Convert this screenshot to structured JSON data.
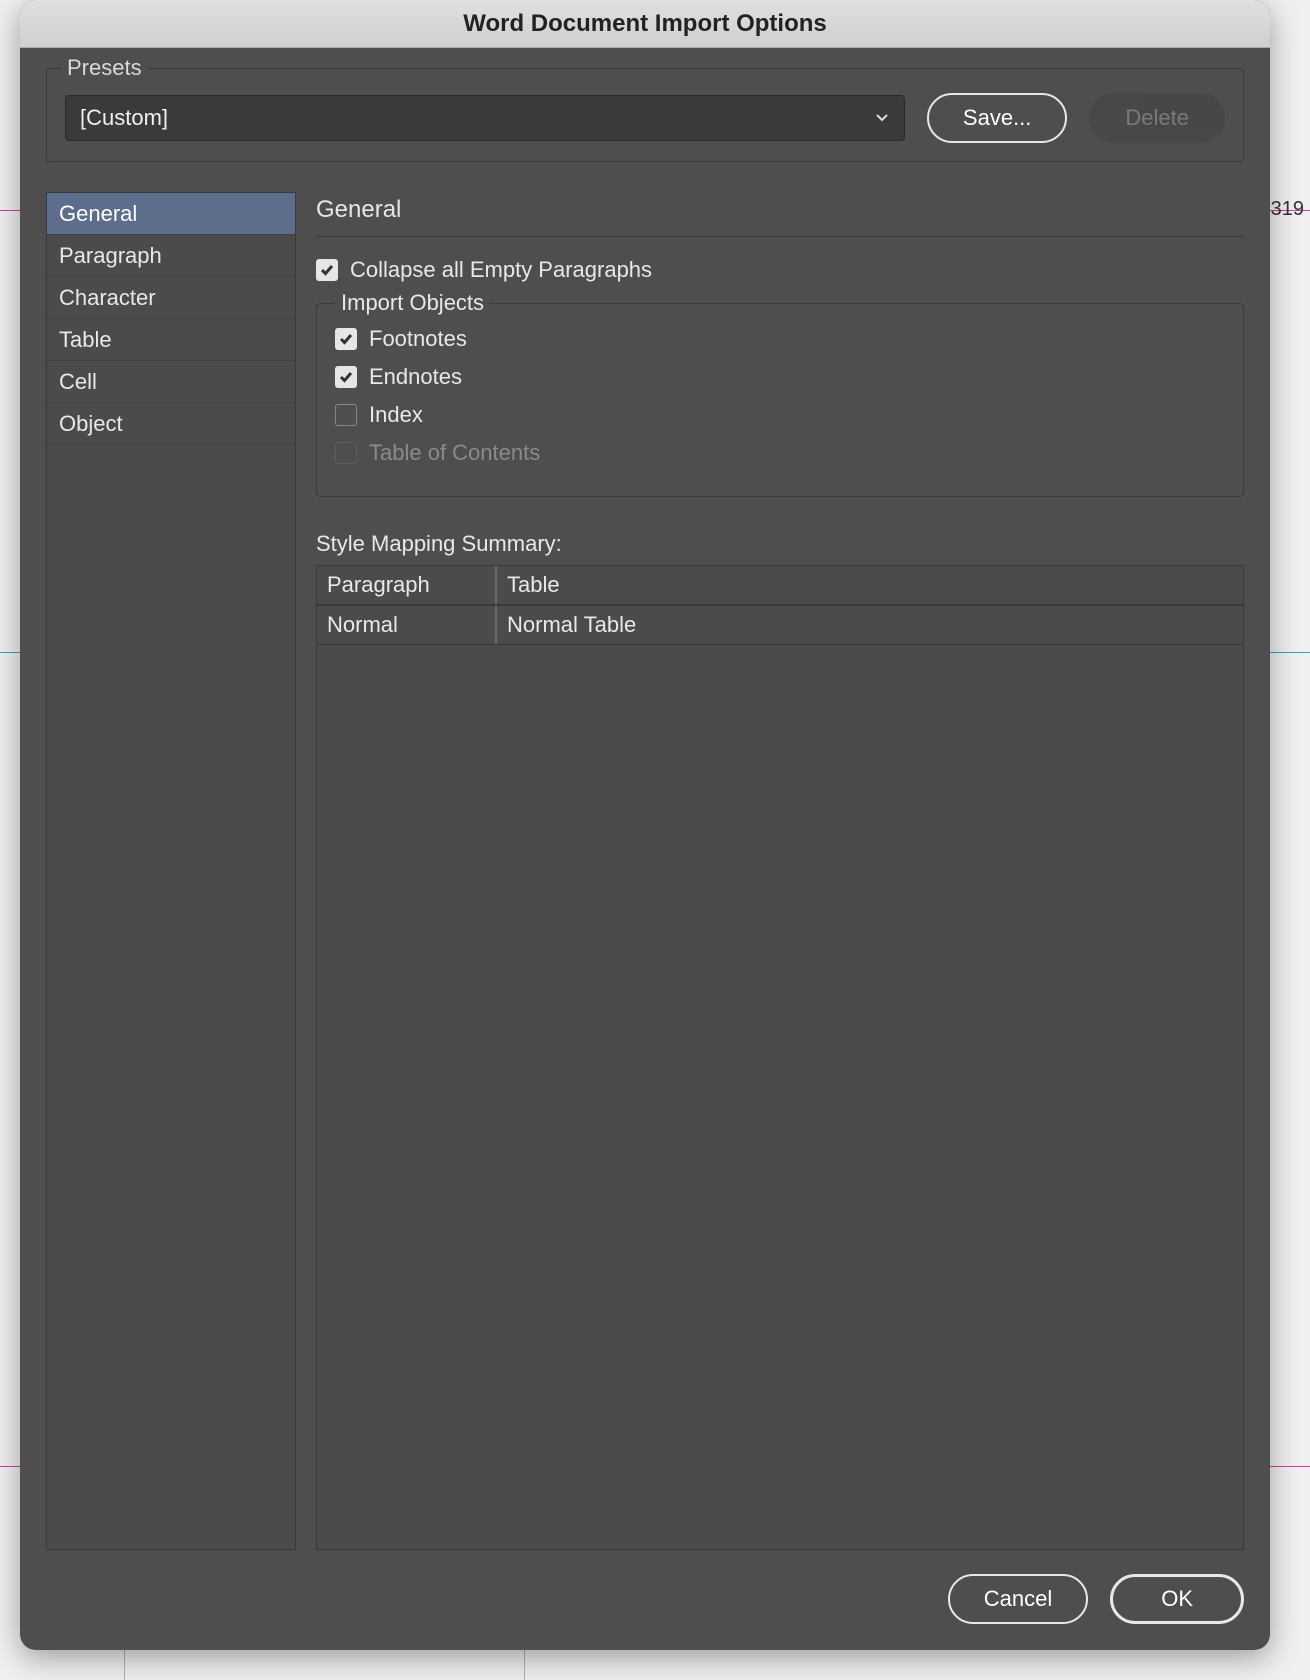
{
  "dialog": {
    "title": "Word Document Import Options",
    "presets": {
      "legend": "Presets",
      "selected": "[Custom]",
      "save_label": "Save...",
      "delete_label": "Delete"
    },
    "sidebar": {
      "items": [
        {
          "label": "General",
          "active": true
        },
        {
          "label": "Paragraph",
          "active": false
        },
        {
          "label": "Character",
          "active": false
        },
        {
          "label": "Table",
          "active": false
        },
        {
          "label": "Cell",
          "active": false
        },
        {
          "label": "Object",
          "active": false
        }
      ]
    },
    "panel": {
      "title": "General",
      "collapse_label": "Collapse all Empty Paragraphs",
      "collapse_checked": true,
      "import_objects": {
        "legend": "Import Objects",
        "items": [
          {
            "label": "Footnotes",
            "checked": true,
            "disabled": false
          },
          {
            "label": "Endnotes",
            "checked": true,
            "disabled": false
          },
          {
            "label": "Index",
            "checked": false,
            "disabled": false
          },
          {
            "label": "Table of Contents",
            "checked": false,
            "disabled": true
          }
        ]
      },
      "summary": {
        "label": "Style Mapping Summary:",
        "headers": {
          "paragraph": "Paragraph",
          "table": "Table"
        },
        "rows": [
          {
            "paragraph": "Normal",
            "table": "Normal Table"
          }
        ]
      }
    },
    "footer": {
      "cancel": "Cancel",
      "ok": "OK"
    }
  },
  "background": {
    "number_right": "319"
  }
}
